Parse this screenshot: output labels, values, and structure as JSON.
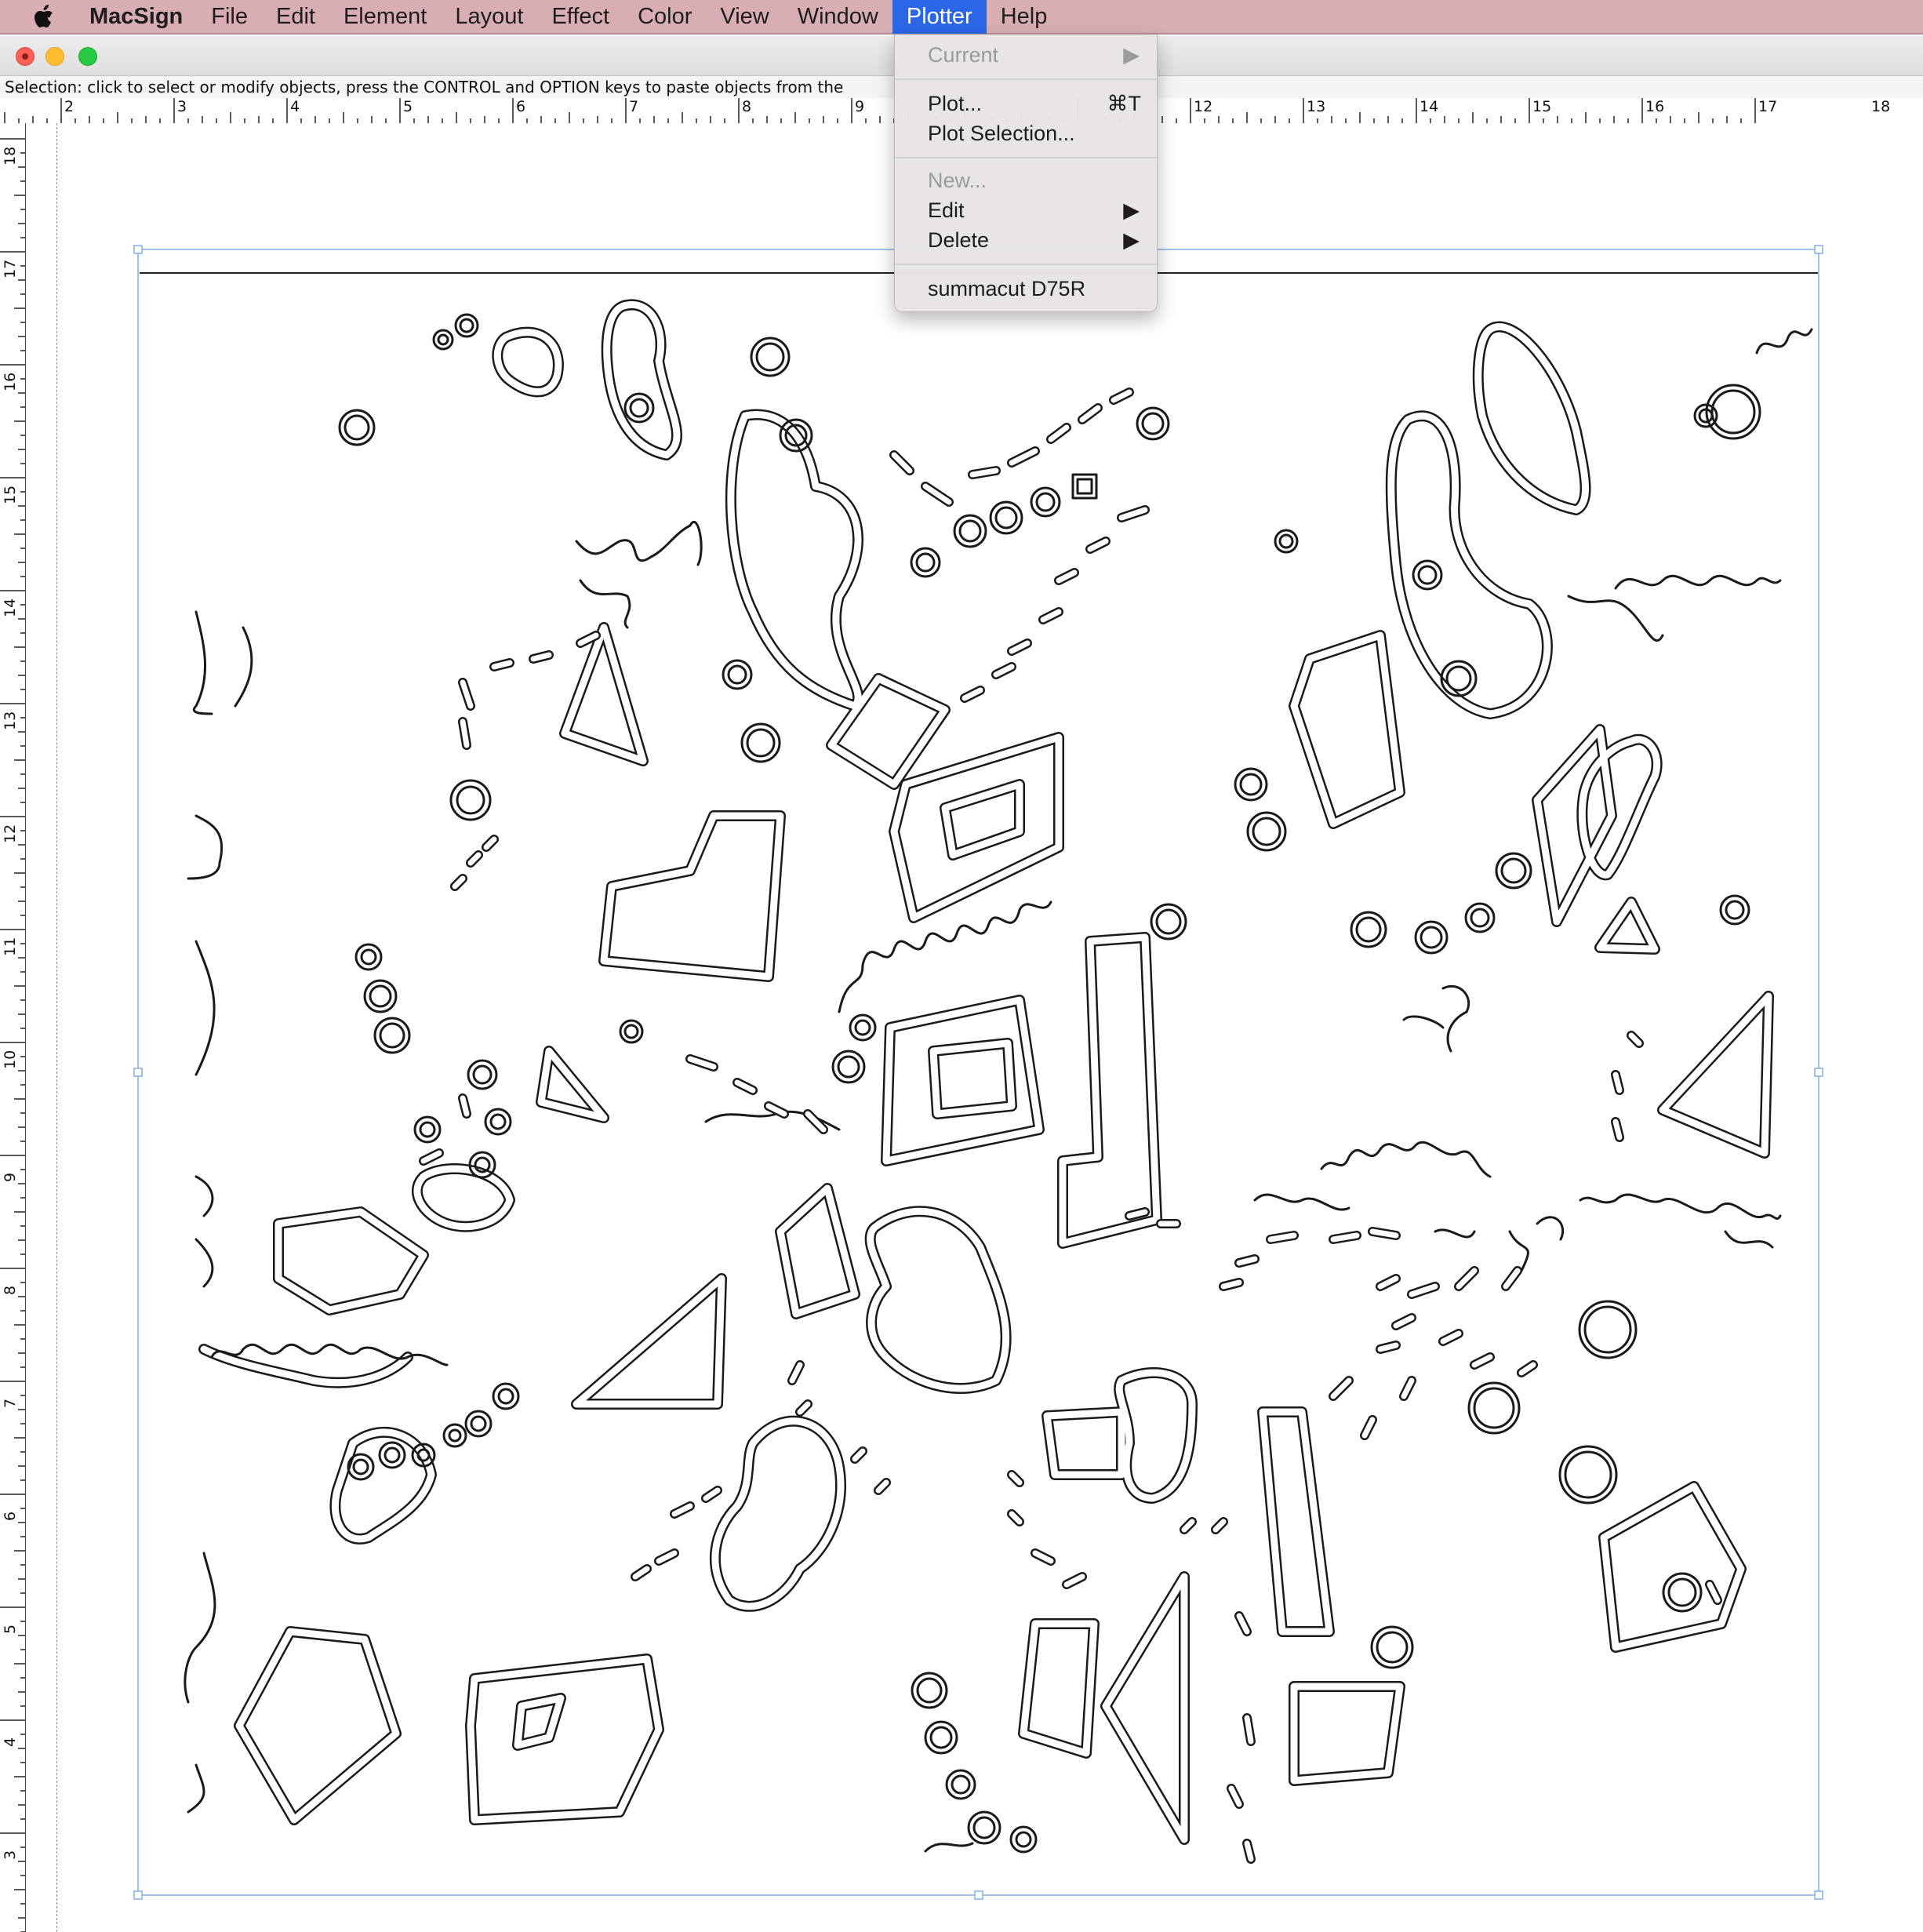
{
  "menubar": {
    "app_name": "MacSign",
    "menus": [
      "File",
      "Edit",
      "Element",
      "Layout",
      "Effect",
      "Color",
      "View",
      "Window",
      "Plotter",
      "Help"
    ],
    "active_menu": "Plotter"
  },
  "status": {
    "text": "Selection: click to select or modify objects, press the CONTROL and OPTION keys to paste objects from the"
  },
  "ruler": {
    "horizontal_labels": [
      "2",
      "3",
      "4",
      "5",
      "6",
      "7",
      "8",
      "9",
      "12",
      "13",
      "14",
      "15",
      "16",
      "17",
      "18"
    ],
    "vertical_labels": [
      "18",
      "17",
      "16",
      "15",
      "14",
      "13",
      "12",
      "11",
      "10",
      "9",
      "8",
      "7",
      "6",
      "5",
      "4",
      "3"
    ]
  },
  "plotter_menu": {
    "current": "Current",
    "plot": "Plot...",
    "plot_shortcut": "⌘T",
    "plot_selection": "Plot Selection...",
    "new": "New...",
    "edit": "Edit",
    "delete": "Delete",
    "device": "summacut D75R",
    "submenu_arrow": "▶"
  },
  "colors": {
    "menubar": "#d8aeb4",
    "highlight": "#2b66e6",
    "selection_handle": "#7fb1e6"
  }
}
